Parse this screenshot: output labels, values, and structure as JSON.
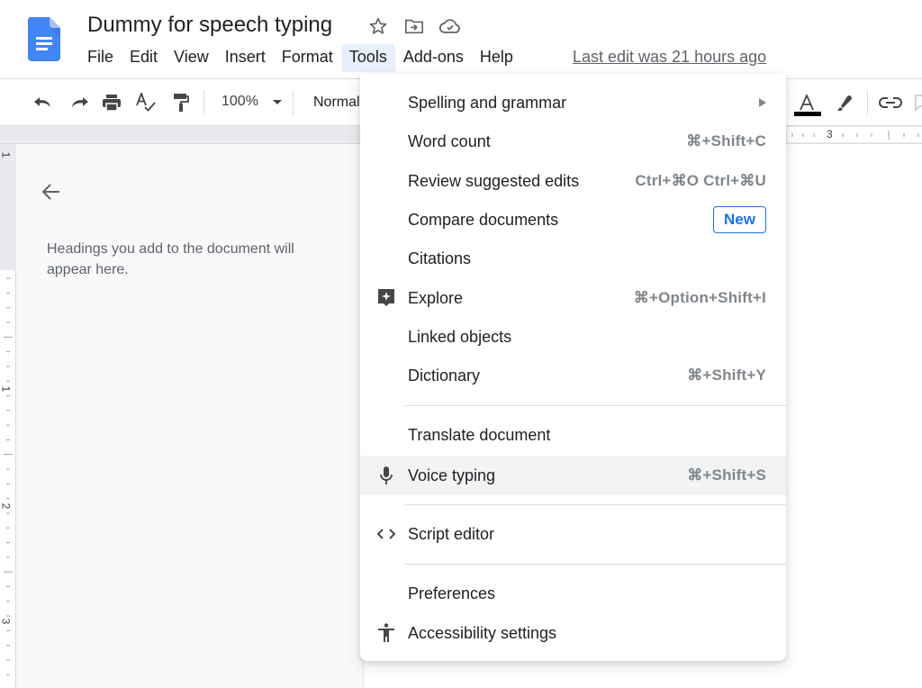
{
  "header": {
    "doc_title": "Dummy for speech typing",
    "icons": [
      "star-icon",
      "move-to-folder-icon",
      "cloud-saved-icon"
    ],
    "last_edit": "Last edit was 21 hours ago"
  },
  "menubar": {
    "items": [
      {
        "label": "File"
      },
      {
        "label": "Edit"
      },
      {
        "label": "View"
      },
      {
        "label": "Insert"
      },
      {
        "label": "Format"
      },
      {
        "label": "Tools",
        "active": true
      },
      {
        "label": "Add-ons"
      },
      {
        "label": "Help"
      }
    ]
  },
  "toolbar": {
    "zoom": "100%",
    "paragraph_style": "Normal",
    "text_color": "#000000",
    "icons": [
      "undo-icon",
      "redo-icon",
      "print-icon",
      "spellcheck-icon",
      "paint-format-icon",
      "text-color-icon",
      "highlight-icon",
      "link-icon",
      "comment-icon"
    ]
  },
  "ruler": {
    "top_label": "3",
    "left_labels": [
      "1",
      "1",
      "2",
      "3"
    ]
  },
  "outline": {
    "hint": "Headings you add to the document will appear here."
  },
  "tools_menu": {
    "items": [
      {
        "label": "Spelling and grammar",
        "submenu": true
      },
      {
        "label": "Word count",
        "shortcut": "⌘+Shift+C"
      },
      {
        "label": "Review suggested edits",
        "shortcut": "Ctrl+⌘O Ctrl+⌘U"
      },
      {
        "label": "Compare documents",
        "badge": "New"
      },
      {
        "label": "Citations"
      },
      {
        "label": "Explore",
        "shortcut": "⌘+Option+Shift+I",
        "icon": "explore-icon"
      },
      {
        "label": "Linked objects"
      },
      {
        "label": "Dictionary",
        "shortcut": "⌘+Shift+Y"
      },
      {
        "label": "Translate document"
      },
      {
        "label": "Voice typing",
        "shortcut": "⌘+Shift+S",
        "icon": "microphone-icon",
        "highlighted": true
      },
      {
        "label": "Script editor",
        "icon": "code-icon"
      },
      {
        "label": "Preferences"
      },
      {
        "label": "Accessibility settings",
        "icon": "accessibility-icon"
      }
    ]
  },
  "colors": {
    "brand_blue": "#4285f4",
    "accent_blue": "#1a73e8",
    "active_menu_bg": "#e8f0fe",
    "hover_bg": "#f1f3f4"
  }
}
